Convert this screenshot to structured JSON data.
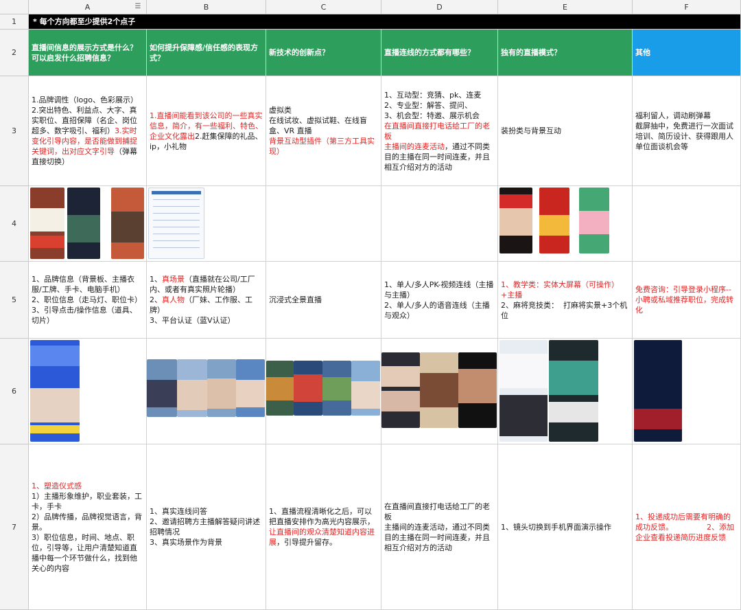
{
  "columns": [
    "A",
    "B",
    "C",
    "D",
    "E",
    "F"
  ],
  "rows": [
    "1",
    "2",
    "3",
    "4",
    "5",
    "6",
    "7"
  ],
  "title": "* 每个方向都至少提供2个点子",
  "headers": [
    "直播间信息的展示方式是什么？可以启发什么招聘信息？",
    "如何提升保障感/信任感的表现方式？",
    "新技术的创新点？",
    "直播连线的方式都有哪些？",
    "独有的直播模式？",
    "其他"
  ],
  "row3": {
    "a": [
      {
        "text": "1.品牌调性（logo、色彩展示）\n2.突出特色、利益点、大字、真实职位、直招保障（名企、岗位超多、数字吸引、福利）",
        "red": false
      },
      {
        "text": "3.实时变化引导内容，是否能做到捕捉关键词，出对应文字引导",
        "red": true
      },
      {
        "text": "（弹幕直接切换）",
        "red": false
      }
    ],
    "b": [
      {
        "text": "1.直播间能看到该公司的一些真实信息，简介，有一些福利、特色、企业文化露出",
        "red": true
      },
      {
        "text": "2.赶集保障的礼品、ip，小礼物",
        "red": false
      }
    ],
    "c": [
      {
        "text": "虚拟类\n在线试妆、虚拟试鞋、在线盲盒、VR 直播",
        "red": false
      },
      {
        "text": " ",
        "red": false
      },
      {
        "text": "背景互动型插件（第三方工具实现）",
        "red": true
      }
    ],
    "d": [
      {
        "text": "1、互动型：竞猜、pk、连麦\n2、专业型：解答、提问、\n3、机会型：特邀、展示机会",
        "red": false
      },
      {
        "text": " ",
        "red": false
      },
      {
        "text": "在直播间直接打电话给工厂的老板\n主播间的连麦活动",
        "red": true
      },
      {
        "text": "，通过不同类目的主播在同一时间连麦，并且相互介绍对方的活动",
        "red": false
      }
    ],
    "e": [
      {
        "text": "装扮类与背景互动",
        "red": false
      }
    ],
    "f": [
      {
        "text": "福利留人，调动刷弹幕\n截屏抽中，免费进行一次面试培训、简历设计、获得跟用人单位面谈机会等",
        "red": false
      }
    ]
  },
  "row5": {
    "a": [
      {
        "text": "1、品牌信息（背景板、主播衣服/工牌、手卡、电脑手机）\n2、职位信息（走马灯、职位卡）\n3、引导点击/操作信息（道具、切片）",
        "red": false
      }
    ],
    "b": [
      {
        "text": "1、",
        "red": false
      },
      {
        "text": "真场景",
        "red": true
      },
      {
        "text": "（直播就在公司/工厂内、或者有真实照片轮播）\n2、",
        "red": false
      },
      {
        "text": "真人物",
        "red": true
      },
      {
        "text": "（厂妹、工作服、工牌）\n3、平台认证（蓝V认证）",
        "red": false
      }
    ],
    "c": [
      {
        "text": "沉浸式全景直播",
        "red": false
      }
    ],
    "d": [
      {
        "text": "1、单人/多人PK-视频连线（主播与主播）\n2、单人/多人的语音连线（主播与观众）",
        "red": false
      }
    ],
    "e": [
      {
        "text": "1、教学类：实体大屏幕（可操作）+主播",
        "red": true
      },
      {
        "text": "\n2、麻将竞技类：  打麻将实景+3个机位",
        "red": false
      }
    ],
    "f": [
      {
        "text": "免费咨询：引导登录小程序--小聘或私域推荐职位，完成转化",
        "red": true
      }
    ]
  },
  "row7": {
    "a": [
      {
        "text": "1、塑造仪式感",
        "red": true
      },
      {
        "text": "\n1）主播形象维护，职业套装，工卡，手卡\n2）品牌传播，品牌视觉语言，背景。\n3）职位信息，时间、地点、职位，引导等，让用户清楚知道直播中每一个环节做什么，找到他关心的内容",
        "red": false
      }
    ],
    "b": [
      {
        "text": "1、真实连线问答\n2、邀请招聘方主播解答疑问讲述招聘情况\n3、真实场景作为背景",
        "red": false
      }
    ],
    "c": [
      {
        "text": "1、直播流程清晰化之后，可以把直播安排作为高光内容展示，",
        "red": false
      },
      {
        "text": "让直播间的观众清楚知道内容进展",
        "red": true
      },
      {
        "text": "，引导提升留存。",
        "red": false
      }
    ],
    "d": [
      {
        "text": "在直播间直接打电话给工厂的老板\n主播间的连麦活动，通过不同类目的主播在同一时间连麦，并且相互介绍对方的活动",
        "red": false
      }
    ],
    "e": [
      {
        "text": "1、镜头切换到手机界面演示操作",
        "red": false
      }
    ],
    "f": [
      {
        "text": "1、投递成功后需要有明确的成功反馈。              2、添加企业查看投递简历进度反馈",
        "red": true
      }
    ]
  },
  "colors": {
    "header_green": "#2e9e5c",
    "header_blue": "#1a9de8",
    "title_bg": "#000000",
    "red_text": "#e02424"
  },
  "icons": {
    "filter": "filter-icon"
  }
}
